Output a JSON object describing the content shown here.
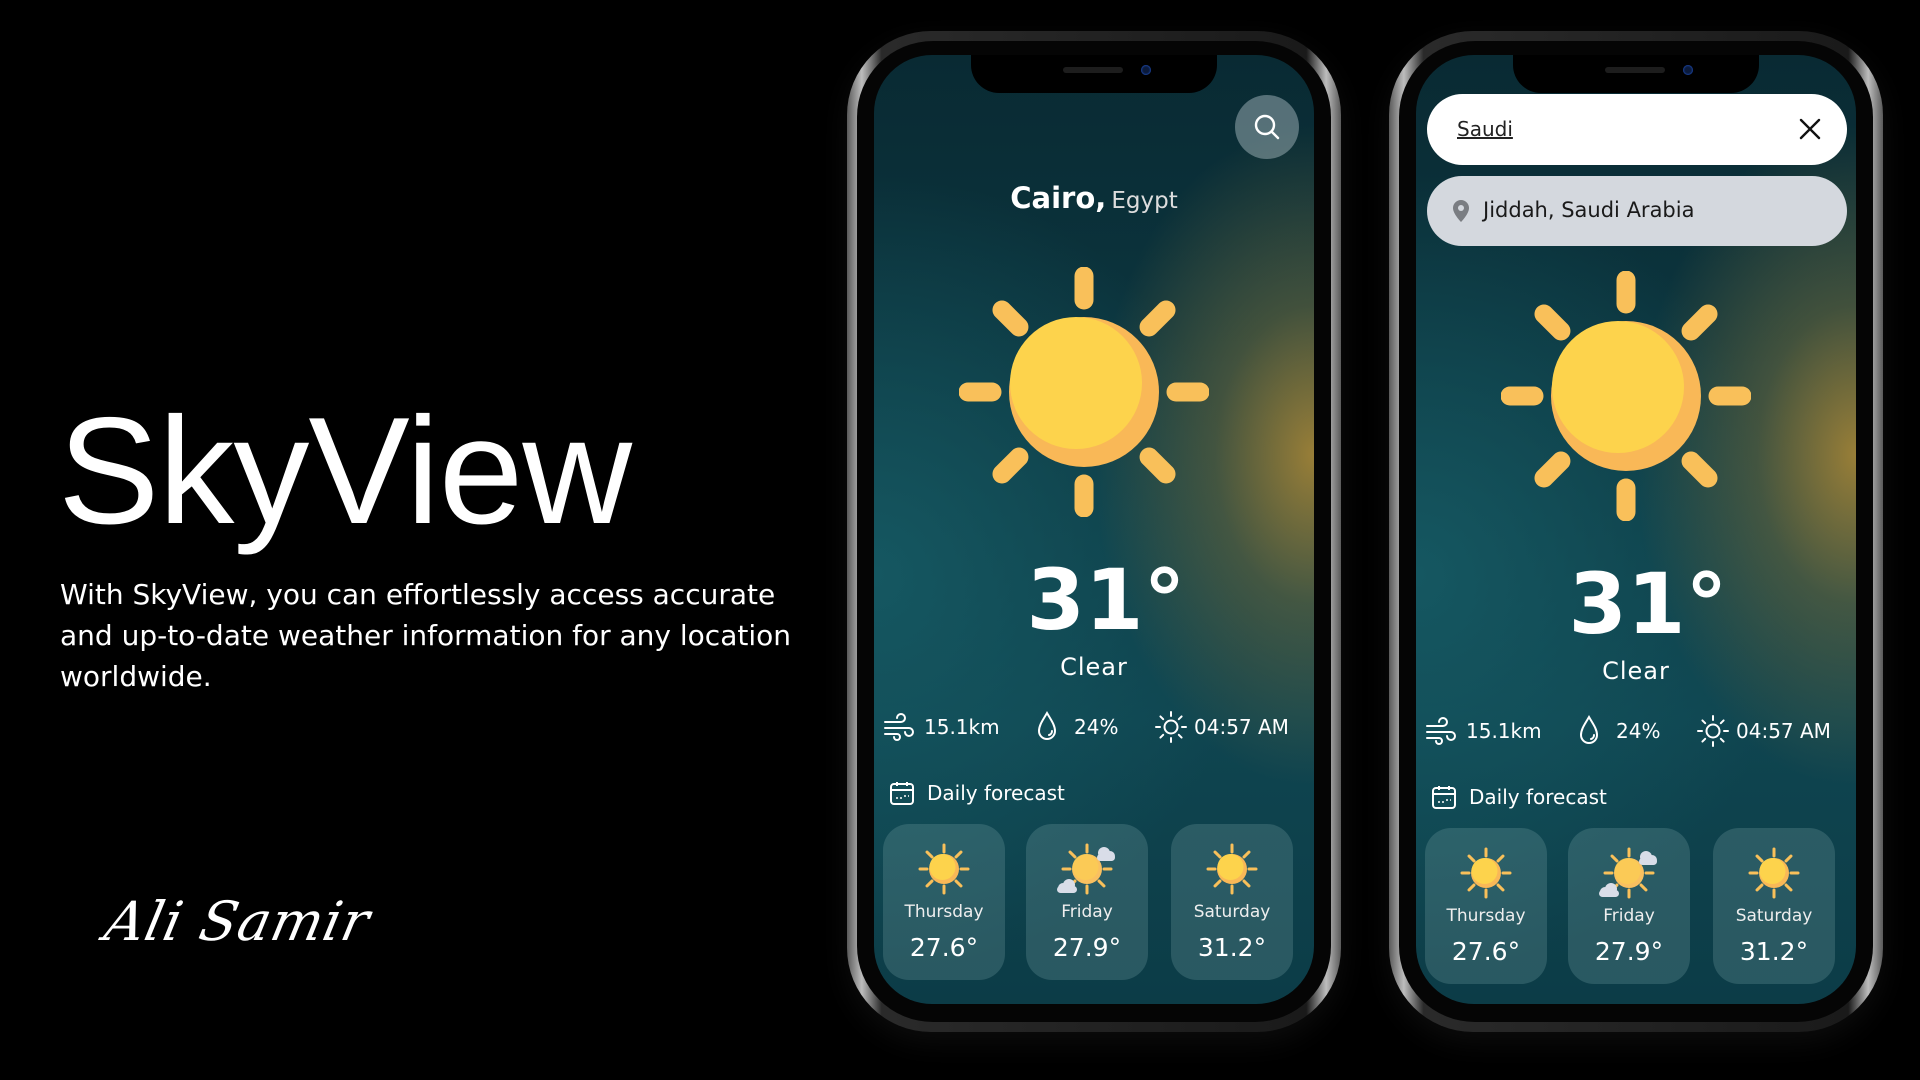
{
  "hero": {
    "title": "SkyView",
    "description": "With SkyView, you can effortlessly access accurate and up-to-date weather information for any location worldwide.",
    "signature": "Ali Samir"
  },
  "colors": {
    "sun": "#fdd34c",
    "sun_shade": "#f9b857",
    "ray": "#f9c05a",
    "suggestion_bg": "#d4d8de"
  },
  "phones": [
    {
      "search_icon": "search-icon",
      "city": "Cairo,",
      "country": "Egypt",
      "temperature": "31°",
      "condition": "Clear",
      "stats": {
        "wind": "15.1km",
        "humidity": "24%",
        "sunrise": "04:57 AM"
      },
      "daily_label": "Daily forecast",
      "forecast": [
        {
          "day": "Thursday",
          "temp": "27.6°",
          "icon": "sun-icon"
        },
        {
          "day": "Friday",
          "temp": "27.9°",
          "icon": "sun-cloud-icon"
        },
        {
          "day": "Saturday",
          "temp": "31.2°",
          "icon": "sun-icon"
        }
      ]
    },
    {
      "search": {
        "value": "Saudi",
        "close_icon": "close-icon"
      },
      "suggestions": [
        {
          "label": "Jiddah, Saudi Arabia",
          "icon": "location-pin-icon"
        }
      ],
      "temperature": "31°",
      "condition": "Clear",
      "stats": {
        "wind": "15.1km",
        "humidity": "24%",
        "sunrise": "04:57 AM"
      },
      "daily_label": "Daily forecast",
      "forecast": [
        {
          "day": "Thursday",
          "temp": "27.6°",
          "icon": "sun-icon"
        },
        {
          "day": "Friday",
          "temp": "27.9°",
          "icon": "sun-cloud-icon"
        },
        {
          "day": "Saturday",
          "temp": "31.2°",
          "icon": "sun-icon"
        }
      ]
    }
  ]
}
